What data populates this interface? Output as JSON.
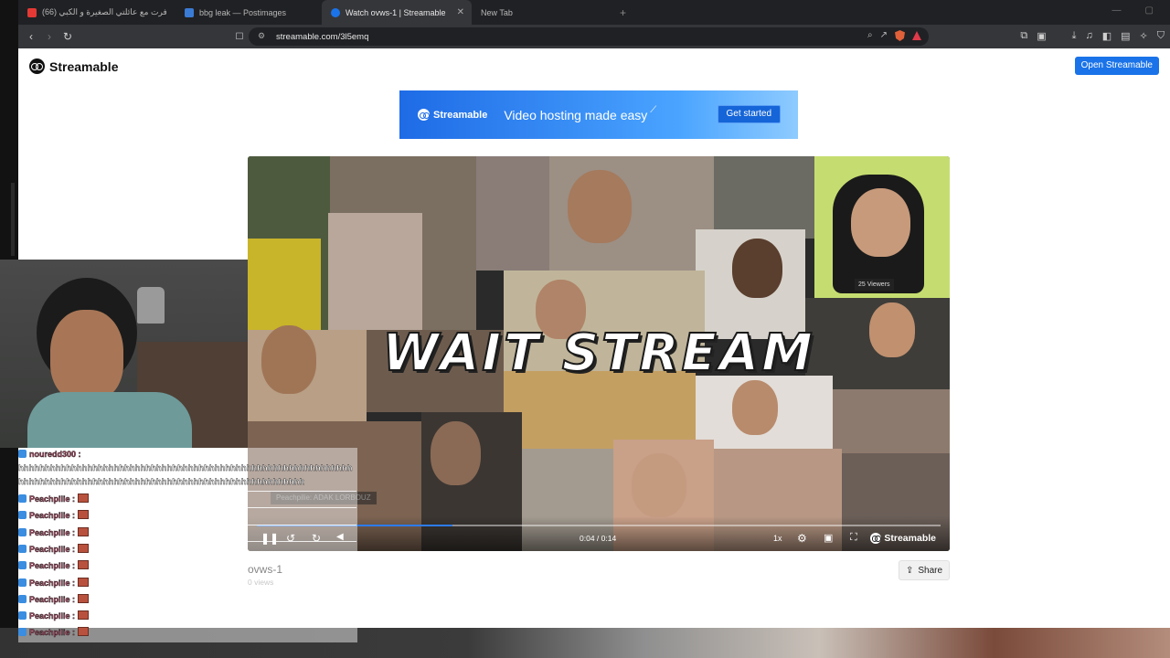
{
  "tabs": [
    {
      "label": "(66) سافرت مع عائلتي الصغيرة و الكبي...",
      "color": "#e53935",
      "active": false
    },
    {
      "label": "bbg leak — Postimages",
      "color": "#3a7bd5",
      "active": false
    },
    {
      "label": "Watch ovws-1 | Streamable",
      "color": "#1a73e8",
      "active": true
    },
    {
      "label": "New Tab",
      "color": "",
      "active": false
    }
  ],
  "address_bar": {
    "url": "streamable.com/3l5emq"
  },
  "header": {
    "brand": "Streamable",
    "open_button": "Open Streamable"
  },
  "banner": {
    "brand": "Streamable",
    "tagline": "Video hosting made easy",
    "cta": "Get started"
  },
  "video": {
    "title_art": "WAIT STREAM",
    "overlay_chat": "Peachpilie: ADAK LORBOUZ",
    "viewers_badge": "25 Viewers",
    "time": "0:04 / 0:14",
    "progress_fraction": 0.286,
    "speed": "1x",
    "player_brand": "Streamable"
  },
  "meta": {
    "name": "ovws-1",
    "views": "0 views",
    "share": "Share"
  },
  "chat": {
    "first_user": "nouredd300 :",
    "first_message_1": "hhhhhhhhhhhhhhhhhhhhhhhhhhhhhhhhhhhhhhhhhhhhhhhhhhhhhhhhhhhhhhh",
    "first_message_2": "hhhhhhhhhhhhhhhhhhhhhhhhhhhhhhhhhhhhhhhhhhhhhhhhhhhhhh",
    "lines": [
      "Peachpilie :",
      "Peachpilie :",
      "Peachpilie :",
      "Peachpilie :",
      "Peachpilie :",
      "Peachpilie :",
      "Peachpilie :",
      "Peachpilie :",
      "Peachpilie :"
    ]
  }
}
